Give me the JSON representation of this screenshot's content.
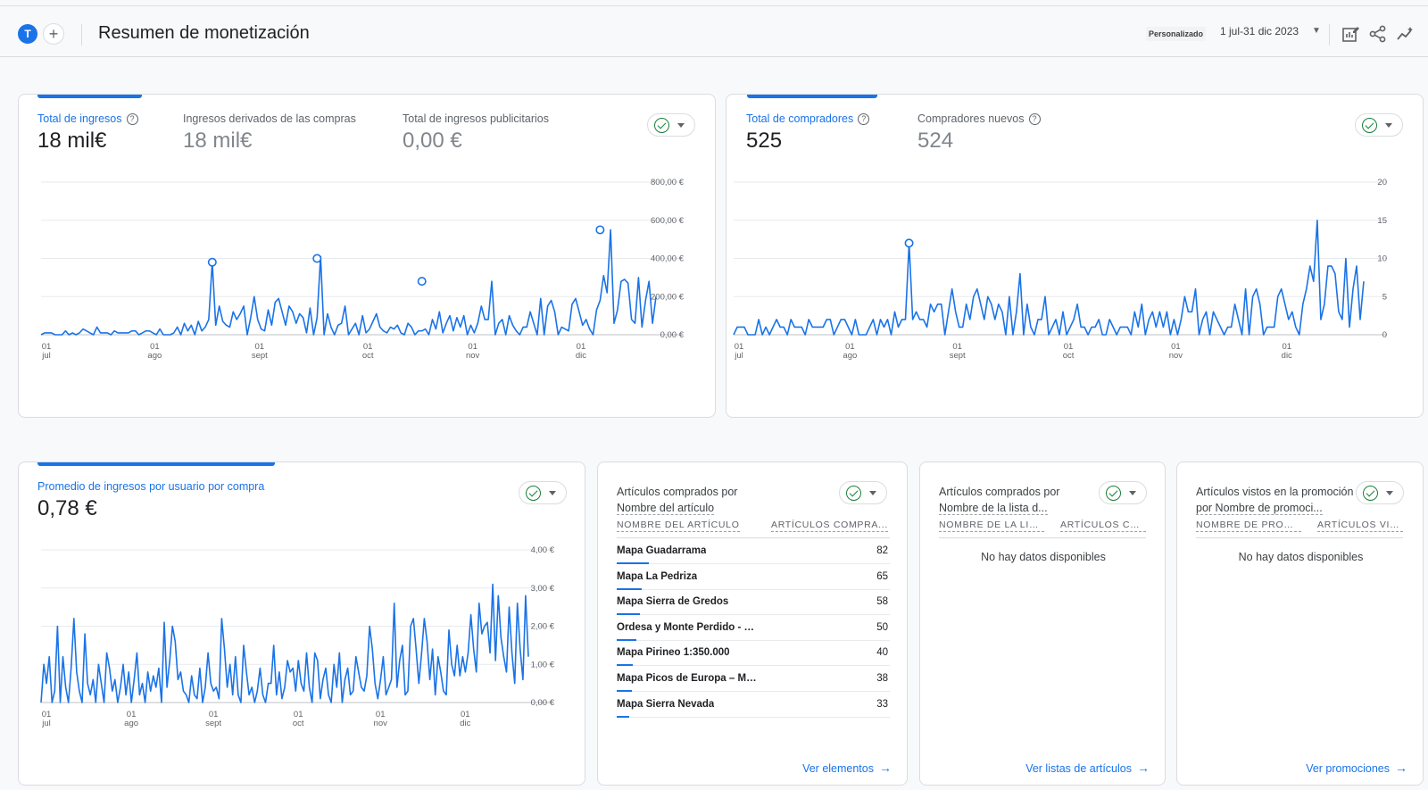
{
  "header": {
    "avatar_letter": "T",
    "add_label": "+",
    "title": "Resumen de monetización",
    "date_chip": "Personalizado",
    "date_range": "1 jul-31 dic 2023",
    "icons": [
      "customize-report-icon",
      "share-icon",
      "insights-icon"
    ]
  },
  "card_revenue": {
    "metrics": [
      {
        "label": "Total de ingresos",
        "value": "18 mil€"
      },
      {
        "label": "Ingresos derivados de las compras",
        "value": "18 mil€"
      },
      {
        "label": "Total de ingresos publicitarios",
        "value": "0,00 €"
      }
    ]
  },
  "card_buyers": {
    "metrics": [
      {
        "label": "Total de compradores",
        "value": "525"
      },
      {
        "label": "Compradores nuevos",
        "value": "524"
      }
    ]
  },
  "card_arppu": {
    "metrics": [
      {
        "label": "Promedio de ingresos por usuario por compra",
        "value": "0,78 €"
      }
    ]
  },
  "items_card": {
    "title_line1": "Artículos comprados por",
    "title_line2": "Nombre del artículo",
    "col1": "NOMBRE DEL ARTÍCULO",
    "col2": "ARTÍCULOS COMPRA...",
    "rows": [
      {
        "name": "Mapa Guadarrama",
        "value": "82",
        "share": 1.0
      },
      {
        "name": "Mapa La Pedriza",
        "value": "65",
        "share": 0.79
      },
      {
        "name": "Mapa Sierra de Gredos",
        "value": "58",
        "share": 0.71
      },
      {
        "name": "Ordesa y Monte Perdido - Ed...",
        "value": "50",
        "share": 0.61
      },
      {
        "name": "Mapa Pirineo 1:350.000",
        "value": "40",
        "share": 0.49
      },
      {
        "name": "Mapa Picos de Europa – Ma...",
        "value": "38",
        "share": 0.46
      },
      {
        "name": "Mapa Sierra Nevada",
        "value": "33",
        "share": 0.4
      }
    ],
    "link": "Ver elementos"
  },
  "lists_card": {
    "title_line1": "Artículos comprados por",
    "title_line2": "Nombre de la lista d...",
    "col1": "NOMBRE DE LA LIS...",
    "col2": "ARTÍCULOS CO...",
    "empty": "No hay datos disponibles",
    "link": "Ver listas de artículos"
  },
  "promo_card": {
    "title_line1": "Artículos vistos en la promoción",
    "title_line2": "por Nombre de promoci...",
    "col1": "NOMBRE DE PROM...",
    "col2": "ARTÍCULOS VIS...",
    "empty": "No hay datos disponibles",
    "link": "Ver promociones"
  },
  "colors": {
    "accent": "#1a73e8",
    "check": "#188038",
    "border": "#dadce0"
  },
  "chart_data": [
    {
      "type": "line",
      "series": [
        {
          "name": "Total de ingresos",
          "values": [
            0,
            10,
            10,
            10,
            0,
            0,
            0,
            20,
            0,
            10,
            0,
            10,
            30,
            20,
            10,
            0,
            40,
            10,
            10,
            10,
            0,
            20,
            10,
            10,
            10,
            10,
            20,
            20,
            0,
            10,
            20,
            20,
            10,
            0,
            30,
            0,
            0,
            0,
            10,
            40,
            0,
            60,
            20,
            50,
            0,
            70,
            20,
            40,
            80,
            380,
            50,
            150,
            70,
            50,
            40,
            120,
            80,
            110,
            150,
            0,
            90,
            200,
            80,
            30,
            20,
            130,
            50,
            170,
            190,
            120,
            50,
            150,
            120,
            60,
            110,
            90,
            10,
            140,
            0,
            90,
            410,
            0,
            110,
            40,
            0,
            50,
            60,
            150,
            0,
            30,
            60,
            0,
            100,
            10,
            30,
            70,
            110,
            40,
            20,
            10,
            40,
            30,
            50,
            10,
            0,
            60,
            40,
            0,
            20,
            20,
            30,
            0,
            80,
            30,
            120,
            10,
            60,
            100,
            20,
            90,
            40,
            100,
            0,
            50,
            10,
            60,
            150,
            80,
            80,
            280,
            0,
            60,
            80,
            0,
            100,
            50,
            20,
            0,
            40,
            40,
            120,
            60,
            0,
            190,
            0,
            150,
            180,
            120,
            0,
            40,
            30,
            20,
            160,
            190,
            120,
            50,
            80,
            30,
            0,
            130,
            180,
            310,
            220,
            550,
            60,
            130,
            280,
            290,
            270,
            80,
            60,
            300,
            40,
            180,
            280,
            60,
            200
          ]
        }
      ],
      "x_tick_labels": [
        [
          "01",
          "jul"
        ],
        [
          "01",
          "ago"
        ],
        [
          "01",
          "sept"
        ],
        [
          "01",
          "oct"
        ],
        [
          "01",
          "nov"
        ],
        [
          "01",
          "dic"
        ]
      ],
      "y_tick_labels": [
        "0,00 €",
        "200,00 €",
        "400,00 €",
        "600,00 €",
        "800,00 €"
      ],
      "ylim": [
        0,
        800
      ],
      "highlight_points": [
        {
          "x": 49,
          "y": 380
        },
        {
          "x": 79,
          "y": 400
        },
        {
          "x": 109,
          "y": 280
        },
        {
          "x": 160,
          "y": 550
        }
      ]
    },
    {
      "type": "line",
      "series": [
        {
          "name": "Total de compradores",
          "values": [
            0,
            1,
            1,
            1,
            0,
            0,
            0,
            2,
            0,
            1,
            0,
            1,
            2,
            1,
            1,
            0,
            2,
            1,
            1,
            1,
            0,
            2,
            1,
            1,
            1,
            1,
            2,
            2,
            0,
            1,
            2,
            2,
            1,
            0,
            2,
            0,
            0,
            0,
            1,
            2,
            0,
            2,
            1,
            2,
            0,
            3,
            1,
            2,
            2,
            12,
            2,
            3,
            2,
            2,
            1,
            4,
            3,
            4,
            4,
            0,
            3,
            6,
            3,
            1,
            1,
            4,
            2,
            5,
            6,
            4,
            2,
            5,
            4,
            2,
            4,
            3,
            0,
            5,
            0,
            3,
            8,
            0,
            4,
            1,
            0,
            2,
            2,
            5,
            0,
            1,
            2,
            0,
            3,
            0,
            1,
            2,
            4,
            1,
            1,
            0,
            1,
            1,
            2,
            0,
            0,
            2,
            1,
            0,
            1,
            1,
            1,
            0,
            3,
            1,
            4,
            0,
            2,
            3,
            1,
            3,
            1,
            3,
            0,
            2,
            0,
            2,
            5,
            3,
            3,
            6,
            0,
            2,
            3,
            0,
            3,
            2,
            1,
            0,
            1,
            1,
            4,
            2,
            0,
            6,
            0,
            5,
            6,
            4,
            0,
            1,
            1,
            1,
            5,
            6,
            4,
            2,
            3,
            1,
            0,
            4,
            6,
            9,
            7,
            15,
            2,
            4,
            9,
            9,
            8,
            3,
            2,
            10,
            1,
            6,
            9,
            2,
            7
          ]
        }
      ],
      "x_tick_labels": [
        [
          "01",
          "jul"
        ],
        [
          "01",
          "ago"
        ],
        [
          "01",
          "sept"
        ],
        [
          "01",
          "oct"
        ],
        [
          "01",
          "nov"
        ],
        [
          "01",
          "dic"
        ]
      ],
      "y_tick_labels": [
        "0",
        "5",
        "10",
        "15",
        "20"
      ],
      "ylim": [
        0,
        20
      ],
      "highlight_points": [
        {
          "x": 49,
          "y": 12
        }
      ]
    },
    {
      "type": "line",
      "series": [
        {
          "name": "Promedio de ingresos por usuario por compra",
          "values": [
            0,
            1,
            0.5,
            1.2,
            0,
            0.3,
            2,
            0,
            1.2,
            0.4,
            0,
            0.9,
            2.2,
            0.8,
            0.3,
            0,
            1.8,
            0.5,
            0.2,
            0.6,
            0,
            1,
            0.5,
            0,
            1.3,
            0.9,
            0.3,
            0.6,
            0,
            0.4,
            1,
            0.2,
            0.8,
            0,
            0.6,
            1.3,
            0.2,
            0.5,
            0,
            0.8,
            0.3,
            0.7,
            0.4,
            0.9,
            0,
            2.1,
            0.4,
            1.1,
            2,
            1.6,
            0.6,
            0.8,
            0.3,
            0.2,
            0,
            0.7,
            0.2,
            0.1,
            0.9,
            0,
            0.4,
            1.3,
            0.5,
            0.3,
            0.4,
            0.1,
            2.2,
            1.4,
            0.4,
            1,
            0.2,
            1.2,
            0.2,
            0,
            1.5,
            0.8,
            0.2,
            0.4,
            0,
            0.3,
            0.9,
            0.2,
            0,
            0.5,
            0.5,
            1.5,
            0.2,
            0.8,
            0.1,
            0.4,
            1.1,
            0.8,
            0.9,
            0.3,
            1.1,
            0.5,
            0.3,
            1.3,
            0.4,
            0,
            1.3,
            1.1,
            0.1,
            0.6,
            0.9,
            0.2,
            0,
            1,
            0.4,
            1.3,
            0,
            0.6,
            0.9,
            0.2,
            0.3,
            1.2,
            0.8,
            0.4,
            0.3,
            0.7,
            2,
            1.4,
            0.5,
            0.1,
            0.6,
            1.2,
            0.2,
            0.4,
            0.6,
            2.6,
            0.4,
            1.1,
            1.5,
            0.2,
            0.3,
            2,
            2.2,
            1.4,
            0.5,
            1.3,
            2.2,
            1.6,
            0.6,
            1.4,
            0.2,
            1.2,
            0.8,
            0.3,
            0.2,
            1.9,
            1,
            0.7,
            1.5,
            0.7,
            1.2,
            0.8,
            1.3,
            2.3,
            1.4,
            0.8,
            2.6,
            1.8,
            2,
            2.1,
            1.3,
            3.1,
            1.1,
            2.8,
            1.7,
            1.2,
            0.8,
            2.5,
            1.3,
            0.5,
            2.6,
            1.4,
            0.6,
            2.8,
            1.2
          ]
        }
      ],
      "x_tick_labels": [
        [
          "01",
          "jul"
        ],
        [
          "01",
          "ago"
        ],
        [
          "01",
          "sept"
        ],
        [
          "01",
          "oct"
        ],
        [
          "01",
          "nov"
        ],
        [
          "01",
          "dic"
        ]
      ],
      "y_tick_labels": [
        "0,00 €",
        "1,00 €",
        "2,00 €",
        "3,00 €",
        "4,00 €"
      ],
      "ylim": [
        0,
        4
      ]
    }
  ]
}
